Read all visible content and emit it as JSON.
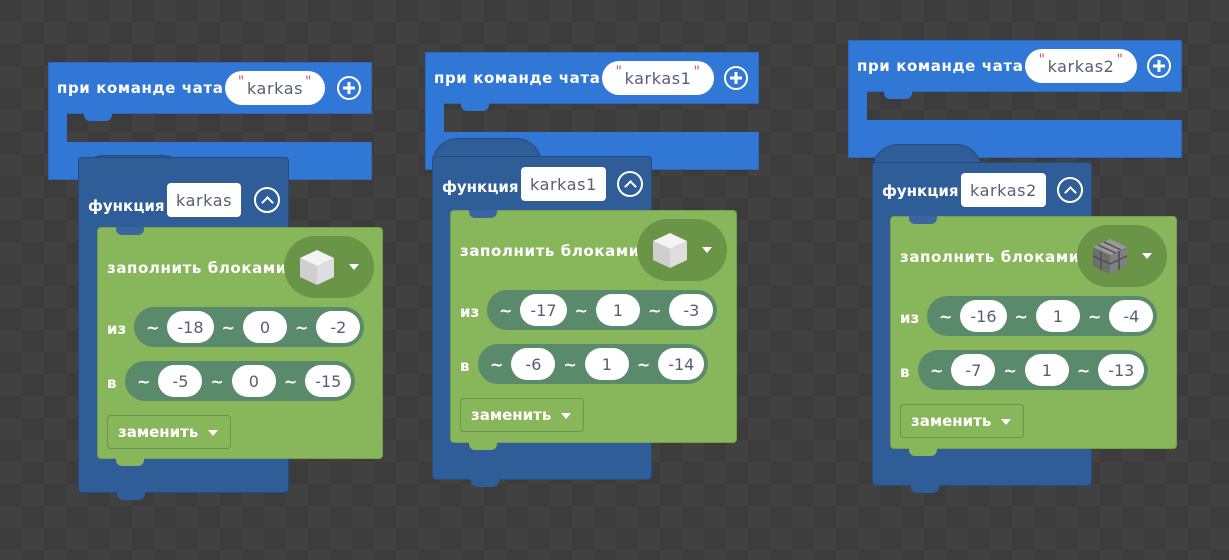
{
  "blocks": [
    {
      "event": {
        "label": "при команде чата",
        "command": "karkas"
      },
      "function": {
        "label": "функция",
        "name": "karkas"
      },
      "fill": {
        "label": "заполнить блоками",
        "block": "smooth-stone-icon",
        "from": {
          "label": "из",
          "tilde": "~",
          "x": "-18",
          "y": "0",
          "z": "-2"
        },
        "to": {
          "label": "в",
          "tilde": "~",
          "x": "-5",
          "y": "0",
          "z": "-15"
        },
        "mode": "заменить"
      }
    },
    {
      "event": {
        "label": "при команде чата",
        "command": "karkas1"
      },
      "function": {
        "label": "функция",
        "name": "karkas1"
      },
      "fill": {
        "label": "заполнить блоками",
        "block": "smooth-stone-icon",
        "from": {
          "label": "из",
          "tilde": "~",
          "x": "-17",
          "y": "1",
          "z": "-3"
        },
        "to": {
          "label": "в",
          "tilde": "~",
          "x": "-6",
          "y": "1",
          "z": "-14"
        },
        "mode": "заменить"
      }
    },
    {
      "event": {
        "label": "при команде чата",
        "command": "karkas2"
      },
      "function": {
        "label": "функция",
        "name": "karkas2"
      },
      "fill": {
        "label": "заполнить блоками",
        "block": "stone-bricks-icon",
        "from": {
          "label": "из",
          "tilde": "~",
          "x": "-16",
          "y": "1",
          "z": "-4"
        },
        "to": {
          "label": "в",
          "tilde": "~",
          "x": "-7",
          "y": "1",
          "z": "-13"
        },
        "mode": "заменить"
      }
    }
  ],
  "colors": {
    "event": "#3177d6",
    "function": "#2f5d98",
    "fill": "#88b65a",
    "vector": "#5a8a6c"
  }
}
